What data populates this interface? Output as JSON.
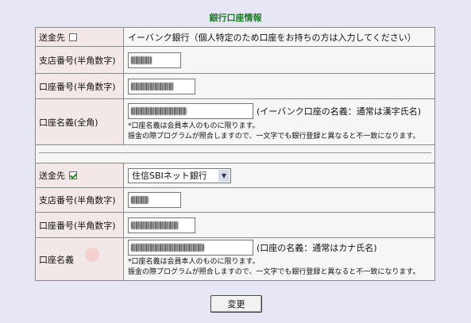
{
  "title": "銀行口座情報",
  "section1": {
    "send_label": "送金先",
    "send_checked": false,
    "send_text": "イーバンク銀行（個人特定のため口座をお持ちの方は入力してください）",
    "branch_label": "支店番号(半角数字)",
    "account_label": "口座番号(半角数字)",
    "name_label": "口座名義(全角)",
    "name_hint": "(イーバンク口座の名義：通常は漢字氏名)",
    "note1": "*口座名義は会員本人のものに限ります。",
    "note2": "振金の際プログラムが照合しますので、一文字でも銀行登録と異なると不一致になります。"
  },
  "section2": {
    "send_label": "送金先",
    "send_checked": true,
    "bank_select": "住信SBIネット銀行",
    "branch_label": "支店番号(半角数字)",
    "account_label": "口座番号(半角数字)",
    "name_label": "口座名義",
    "name_hint": "(口座の名義：通常はカナ氏名)",
    "note1": "*口座名義は会員本人のものに限ります。",
    "note2": "振金の際プログラムが照合しますので、一文字でも銀行登録と異なると不一致になります。"
  },
  "submit_label": "変更"
}
